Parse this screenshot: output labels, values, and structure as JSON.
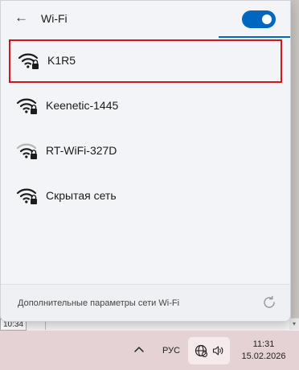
{
  "header": {
    "title": "Wi-Fi",
    "back_icon": "back-arrow-icon",
    "wifi_toggle_on": true,
    "accent": "#0067c0"
  },
  "networks": [
    {
      "name": "K1R5",
      "secured": true,
      "selected": true,
      "signal_icon": "wifi-signal-secured-icon"
    },
    {
      "name": "Keenetic-1445",
      "secured": true,
      "selected": false,
      "signal_icon": "wifi-signal-secured-icon"
    },
    {
      "name": "RT-WiFi-327D",
      "secured": true,
      "selected": false,
      "signal_icon": "wifi-signal-weak-secured-icon"
    },
    {
      "name": "Скрытая сеть",
      "secured": true,
      "selected": false,
      "signal_icon": "wifi-signal-secured-icon"
    }
  ],
  "footer": {
    "more_settings_label": "Дополнительные параметры сети Wi-Fi",
    "refresh_icon": "refresh-icon"
  },
  "background": {
    "time_fragment": "10:34"
  },
  "taskbar": {
    "language": "РУС",
    "time": "11:31",
    "date": "15.02.2026",
    "highlight_color": "#d6141d"
  }
}
